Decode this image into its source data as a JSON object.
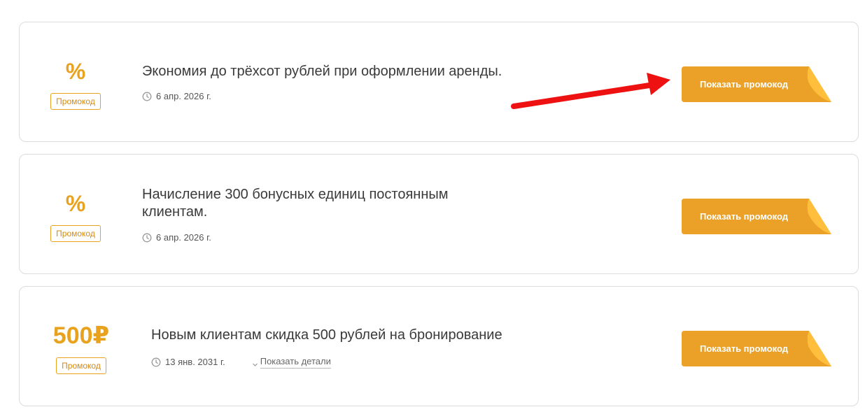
{
  "promos": [
    {
      "value": "%",
      "badge": "Промокод",
      "title": "Экономия до трёхсот рублей при оформлении аренды.",
      "date": "6 апр. 2026 г.",
      "button": "Показать промокод"
    },
    {
      "value": "%",
      "badge": "Промокод",
      "title": "Начисление 300 бонусных единиц постоянным клиентам.",
      "date": "6 апр. 2026 г.",
      "button": "Показать промокод"
    },
    {
      "value": "500₽",
      "badge": "Промокод",
      "title": "Новым клиентам скидка 500 рублей на бронирование",
      "date": "13 янв. 2031 г.",
      "details": "Показать детали",
      "button": "Показать промокод"
    }
  ],
  "colors": {
    "accent": "#e8a21e",
    "button": "#eba127",
    "button_fold": "#ffbf3c",
    "arrow": "#ee1111"
  },
  "icons": {
    "clock": "clock-icon",
    "chevron": "chevron-down-icon",
    "arrow": "red-arrow-icon"
  }
}
